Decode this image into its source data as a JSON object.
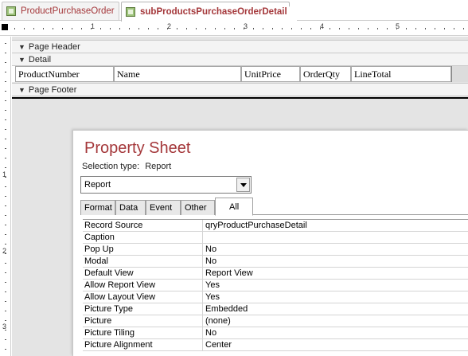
{
  "tabs": [
    {
      "label": "ProductPurchaseOrder",
      "active": false
    },
    {
      "label": "subProductsPurchaseOrderDetail",
      "active": true
    }
  ],
  "ruler": {
    "horizontal_marks": [
      "1",
      "2",
      "3",
      "4",
      "5"
    ],
    "vertical_marks": [
      "1",
      "2",
      "3"
    ]
  },
  "sections": {
    "page_header": "Page Header",
    "detail": "Detail",
    "page_footer": "Page Footer"
  },
  "detail_controls": [
    {
      "label": "ProductNumber"
    },
    {
      "label": "Name"
    },
    {
      "label": "UnitPrice"
    },
    {
      "label": "OrderQty"
    },
    {
      "label": "LineTotal"
    }
  ],
  "property_sheet": {
    "title": "Property Sheet",
    "selection_type_label": "Selection type:",
    "selection_type_value": "Report",
    "selected_object": "Report",
    "tabs": [
      "Format",
      "Data",
      "Event",
      "Other",
      "All"
    ],
    "active_tab": "All",
    "properties": [
      {
        "name": "Record Source",
        "value": "qryProductPurchaseDetail"
      },
      {
        "name": "Caption",
        "value": ""
      },
      {
        "name": "Pop Up",
        "value": "No"
      },
      {
        "name": "Modal",
        "value": "No"
      },
      {
        "name": "Default View",
        "value": "Report View"
      },
      {
        "name": "Allow Report View",
        "value": "Yes"
      },
      {
        "name": "Allow Layout View",
        "value": "Yes"
      },
      {
        "name": "Picture Type",
        "value": "Embedded"
      },
      {
        "name": "Picture",
        "value": "(none)"
      },
      {
        "name": "Picture Tiling",
        "value": "No"
      },
      {
        "name": "Picture Alignment",
        "value": "Center"
      }
    ]
  },
  "colors": {
    "accent": "#a4373a",
    "design_surface": "#e4e4e4"
  }
}
